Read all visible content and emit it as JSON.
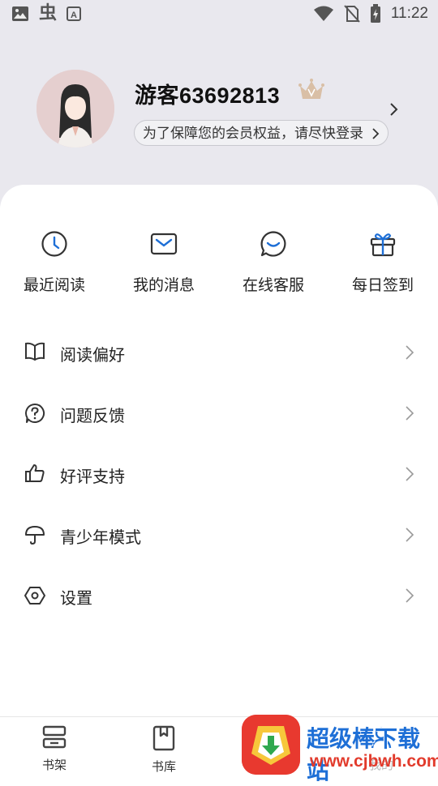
{
  "status_bar": {
    "left_icons": [
      "image-icon",
      "bug-icon",
      "a-icon"
    ],
    "time": "11:22",
    "right_icons": [
      "wifi-icon",
      "no-sim-icon",
      "battery-charging-icon"
    ]
  },
  "profile": {
    "username": "游客63692813",
    "login_prompt": "为了保障您的会员权益，请尽快登录"
  },
  "quick_actions": [
    {
      "label": "最近阅读",
      "icon": "clock-icon"
    },
    {
      "label": "我的消息",
      "icon": "mail-icon"
    },
    {
      "label": "在线客服",
      "icon": "chat-icon"
    },
    {
      "label": "每日签到",
      "icon": "gift-icon"
    }
  ],
  "menu": [
    {
      "label": "阅读偏好",
      "icon": "book-icon"
    },
    {
      "label": "问题反馈",
      "icon": "question-icon"
    },
    {
      "label": "好评支持",
      "icon": "thumbs-up-icon"
    },
    {
      "label": "青少年模式",
      "icon": "umbrella-icon"
    },
    {
      "label": "设置",
      "icon": "settings-icon"
    }
  ],
  "bottom_nav": [
    {
      "label": "书架",
      "icon": "bookshelf-icon"
    },
    {
      "label": "书库",
      "icon": "library-icon"
    },
    {
      "label": "我的",
      "icon": "profile-icon"
    }
  ],
  "watermark": {
    "title": "超级棒下载站",
    "url": "www.cjbwh.com"
  },
  "colors": {
    "header_bg": "#e9e8ee",
    "accent_blue": "#1e6fd6",
    "icon_dark": "#333333"
  }
}
